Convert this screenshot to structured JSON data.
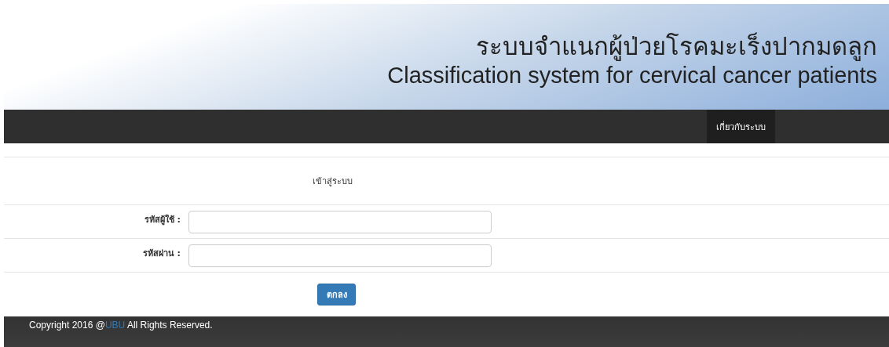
{
  "header": {
    "title_thai": "ระบบจำแนกผู้ป่วยโรคมะเร็งปากมดลูก",
    "title_english": "Classification system for cervical cancer patients"
  },
  "nav": {
    "items": [
      {
        "label": "เกี่ยวกับระบบ",
        "selected": true
      }
    ]
  },
  "login": {
    "heading": "เข้าสู่ระบบ",
    "fields": [
      {
        "label": "รหัสผู้ใช้ :"
      },
      {
        "label": "รหัสผ่าน :"
      }
    ],
    "submit": "ตกลง"
  },
  "footer": {
    "before": "Copyright 2016 @",
    "link": "UBU",
    "after": " All Rights Reserved."
  }
}
